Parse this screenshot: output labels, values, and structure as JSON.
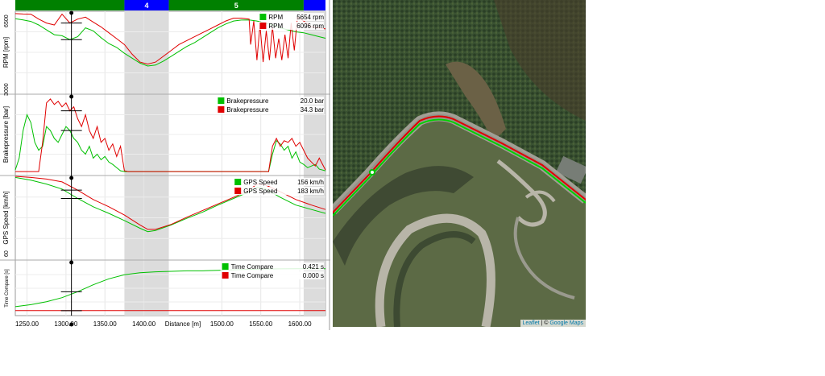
{
  "sectors": [
    {
      "label": "",
      "from": 1235,
      "to": 1375,
      "color": "#008000"
    },
    {
      "label": "4",
      "from": 1375,
      "to": 1432,
      "color": "#0000ff"
    },
    {
      "label": "5",
      "from": 1432,
      "to": 1605,
      "color": "#008000"
    },
    {
      "label": "",
      "from": 1605,
      "to": 1633,
      "color": "#0000ff"
    }
  ],
  "shaded_ranges": [
    [
      1375,
      1432
    ],
    [
      1605,
      1633
    ]
  ],
  "cursor": {
    "distance": 1307
  },
  "chart_data": [
    {
      "type": "line",
      "ylabel": "RPM [rpm]",
      "ylim": [
        2800,
        7000
      ],
      "yticks": [
        "3000",
        "6500"
      ],
      "ytick_values": [
        3000,
        6500
      ],
      "series": [
        {
          "name": "RPM",
          "value": "5654",
          "unit": "rpm",
          "color": "#00c000",
          "x": [
            1235,
            1245,
            1255,
            1265,
            1275,
            1285,
            1295,
            1305,
            1315,
            1325,
            1335,
            1345,
            1355,
            1365,
            1375,
            1385,
            1395,
            1405,
            1415,
            1425,
            1435,
            1445,
            1455,
            1465,
            1475,
            1485,
            1495,
            1505,
            1515,
            1525,
            1535,
            1545,
            1555,
            1565,
            1575,
            1585,
            1595,
            1605,
            1615,
            1625,
            1633
          ],
          "y": [
            6620,
            6560,
            6480,
            6300,
            6050,
            5800,
            5750,
            5550,
            5700,
            6150,
            6000,
            5650,
            5350,
            5150,
            4850,
            4600,
            4350,
            4200,
            4250,
            4450,
            4700,
            4950,
            5200,
            5400,
            5650,
            5900,
            6150,
            6350,
            6500,
            6550,
            6560,
            6500,
            6400,
            6300,
            6150,
            6050,
            5950,
            5900,
            5800,
            5700,
            5620
          ]
        },
        {
          "name": "RPM",
          "value": "6096",
          "unit": "rpm",
          "color": "#e00000",
          "x": [
            1235,
            1245,
            1255,
            1265,
            1275,
            1285,
            1295,
            1305,
            1315,
            1325,
            1335,
            1345,
            1355,
            1365,
            1375,
            1385,
            1395,
            1405,
            1415,
            1425,
            1435,
            1445,
            1455,
            1465,
            1475,
            1485,
            1495,
            1505,
            1515,
            1525,
            1535,
            1537,
            1541,
            1545,
            1549,
            1553,
            1557,
            1561,
            1565,
            1569,
            1573,
            1577,
            1581,
            1585,
            1589,
            1593,
            1597,
            1605,
            1615,
            1625,
            1633
          ],
          "y": [
            6880,
            6860,
            6850,
            6600,
            6400,
            6300,
            6850,
            6400,
            6600,
            6700,
            6450,
            6200,
            5900,
            5600,
            5300,
            4800,
            4400,
            4300,
            4400,
            4700,
            5000,
            5300,
            5500,
            5700,
            5900,
            6100,
            6300,
            6500,
            6650,
            6650,
            6600,
            5300,
            6500,
            4500,
            6300,
            4400,
            6000,
            4500,
            6200,
            4600,
            5600,
            4500,
            5800,
            4600,
            6400,
            5000,
            6700,
            6500,
            6200,
            6150,
            6100
          ]
        }
      ]
    },
    {
      "type": "line",
      "ylabel": "Brakepressure [bar]",
      "ylim": [
        0,
        100
      ],
      "series": [
        {
          "name": "Brakepressure",
          "value": "20.0",
          "unit": "bar",
          "color": "#00c000",
          "x": [
            1235,
            1240,
            1245,
            1250,
            1255,
            1260,
            1265,
            1270,
            1275,
            1280,
            1285,
            1290,
            1295,
            1300,
            1305,
            1310,
            1315,
            1320,
            1325,
            1330,
            1335,
            1340,
            1345,
            1350,
            1355,
            1360,
            1365,
            1370,
            1375,
            1380,
            1385,
            1560,
            1565,
            1570,
            1575,
            1580,
            1585,
            1590,
            1595,
            1600,
            1605,
            1610,
            1615,
            1620,
            1625,
            1633
          ],
          "y": [
            5,
            20,
            55,
            75,
            65,
            40,
            30,
            35,
            60,
            55,
            45,
            40,
            50,
            60,
            55,
            45,
            40,
            30,
            25,
            35,
            20,
            25,
            18,
            22,
            15,
            12,
            8,
            4,
            3,
            3,
            3,
            3,
            25,
            42,
            38,
            30,
            35,
            20,
            28,
            15,
            12,
            8,
            10,
            12,
            6,
            4
          ]
        },
        {
          "name": "Brakepressure",
          "value": "34.3",
          "unit": "bar",
          "color": "#e00000",
          "x": [
            1235,
            1245,
            1255,
            1265,
            1270,
            1275,
            1280,
            1285,
            1290,
            1295,
            1300,
            1305,
            1310,
            1315,
            1320,
            1325,
            1330,
            1335,
            1340,
            1345,
            1350,
            1355,
            1360,
            1365,
            1370,
            1375,
            1380,
            1385,
            1560,
            1565,
            1570,
            1575,
            1580,
            1585,
            1590,
            1595,
            1600,
            1605,
            1610,
            1615,
            1620,
            1625,
            1633
          ],
          "y": [
            3,
            3,
            3,
            3,
            40,
            90,
            95,
            88,
            92,
            85,
            90,
            80,
            85,
            70,
            60,
            75,
            55,
            45,
            60,
            40,
            45,
            30,
            38,
            22,
            35,
            4,
            3,
            3,
            3,
            35,
            45,
            35,
            42,
            40,
            45,
            35,
            40,
            30,
            20,
            15,
            10,
            20,
            5
          ]
        }
      ]
    },
    {
      "type": "line",
      "ylabel": "GPS Speed [km/h]",
      "ylim": [
        50,
        200
      ],
      "yticks": [
        "60"
      ],
      "ytick_values": [
        60
      ],
      "series": [
        {
          "name": "GPS Speed",
          "value": "156",
          "unit": "km/h",
          "color": "#00c000",
          "x": [
            1235,
            1255,
            1275,
            1295,
            1315,
            1335,
            1355,
            1375,
            1395,
            1405,
            1415,
            1435,
            1455,
            1475,
            1495,
            1515,
            1535,
            1545,
            1555,
            1575,
            1595,
            1615,
            1633
          ],
          "y": [
            198,
            193,
            186,
            177,
            160,
            145,
            133,
            120,
            106,
            100,
            102,
            112,
            124,
            135,
            148,
            160,
            172,
            180,
            178,
            162,
            148,
            140,
            133
          ]
        },
        {
          "name": "GPS Speed",
          "value": "183",
          "unit": "km/h",
          "color": "#e00000",
          "x": [
            1235,
            1255,
            1275,
            1295,
            1315,
            1335,
            1355,
            1375,
            1395,
            1405,
            1415,
            1435,
            1455,
            1475,
            1495,
            1515,
            1535,
            1545,
            1555,
            1575,
            1595,
            1615,
            1633
          ],
          "y": [
            200,
            198,
            195,
            190,
            175,
            158,
            145,
            130,
            112,
            104,
            104,
            113,
            126,
            138,
            150,
            162,
            175,
            186,
            185,
            172,
            158,
            148,
            140
          ]
        }
      ]
    },
    {
      "type": "line",
      "ylabel": "Time Compare [s]",
      "ylim": [
        -0.05,
        0.5
      ],
      "series": [
        {
          "name": "Time Compare",
          "value": "0.421",
          "unit": "s",
          "color": "#00c000",
          "x": [
            1235,
            1255,
            1275,
            1295,
            1315,
            1335,
            1355,
            1375,
            1395,
            1415,
            1435,
            1455,
            1475,
            1495,
            1515,
            1535,
            1555,
            1575,
            1595,
            1615,
            1633
          ],
          "y": [
            0.04,
            0.06,
            0.09,
            0.13,
            0.19,
            0.26,
            0.32,
            0.36,
            0.38,
            0.39,
            0.395,
            0.4,
            0.4,
            0.405,
            0.41,
            0.415,
            0.418,
            0.42,
            0.421,
            0.421,
            0.421
          ]
        },
        {
          "name": "Time Compare",
          "value": "0.000",
          "unit": "s",
          "color": "#e00000",
          "x": [
            1235,
            1633
          ],
          "y": [
            0,
            0
          ]
        }
      ]
    }
  ],
  "xaxis": {
    "label": "Distance [m]",
    "ticks": [
      {
        "value": 1250,
        "label": "1250.00"
      },
      {
        "value": 1300,
        "label": "1300.00"
      },
      {
        "value": 1350,
        "label": "1350.00"
      },
      {
        "value": 1400,
        "label": "1400.00"
      },
      {
        "value": 1500,
        "label": "1500.00"
      },
      {
        "value": 1550,
        "label": "1550.00"
      },
      {
        "value": 1600,
        "label": "1600.00"
      }
    ],
    "range": [
      1235,
      1633
    ]
  },
  "map": {
    "attribution_leaflet": "Leaflet",
    "attribution_sep": " | © ",
    "attribution_source": "Google Maps"
  }
}
